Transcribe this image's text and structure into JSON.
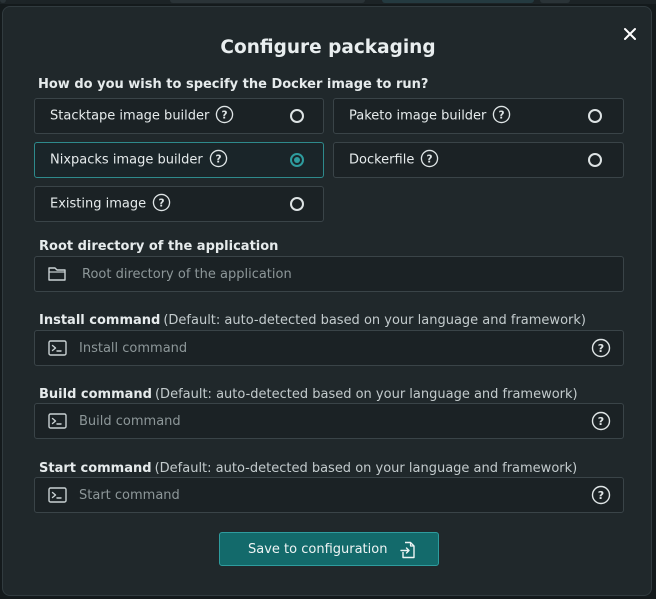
{
  "dialog": {
    "title": "Configure packaging",
    "close_icon": "close-icon"
  },
  "image_spec": {
    "question": "How do you wish to specify the Docker image to run?",
    "selected": "Nixpacks image builder",
    "options": [
      {
        "label": "Stacktape image builder",
        "selected": false
      },
      {
        "label": "Paketo image builder",
        "selected": false
      },
      {
        "label": "Nixpacks image builder",
        "selected": true
      },
      {
        "label": "Dockerfile",
        "selected": false
      },
      {
        "label": "Existing image",
        "selected": false
      }
    ]
  },
  "root_dir": {
    "label": "Root directory of the application",
    "placeholder": "Root directory of the application",
    "value": "",
    "icon": "folder-icon"
  },
  "install_cmd": {
    "label": "Install command",
    "hint": "(Default: auto-detected based on your language and framework)",
    "placeholder": "Install command",
    "value": "",
    "icon": "terminal-icon"
  },
  "build_cmd": {
    "label": "Build command",
    "hint": "(Default: auto-detected based on your language and framework)",
    "placeholder": "Build command",
    "value": "",
    "icon": "terminal-icon"
  },
  "start_cmd": {
    "label": "Start command",
    "hint": "(Default: auto-detected based on your language and framework)",
    "placeholder": "Start command",
    "value": "",
    "icon": "terminal-icon"
  },
  "save_button": {
    "label": "Save to configuration",
    "icon": "file-import-icon"
  },
  "colors": {
    "accent": "#2e9c9e",
    "button_bg": "#136a6b",
    "dialog_bg": "#20282b",
    "page_bg": "#141a1c"
  }
}
